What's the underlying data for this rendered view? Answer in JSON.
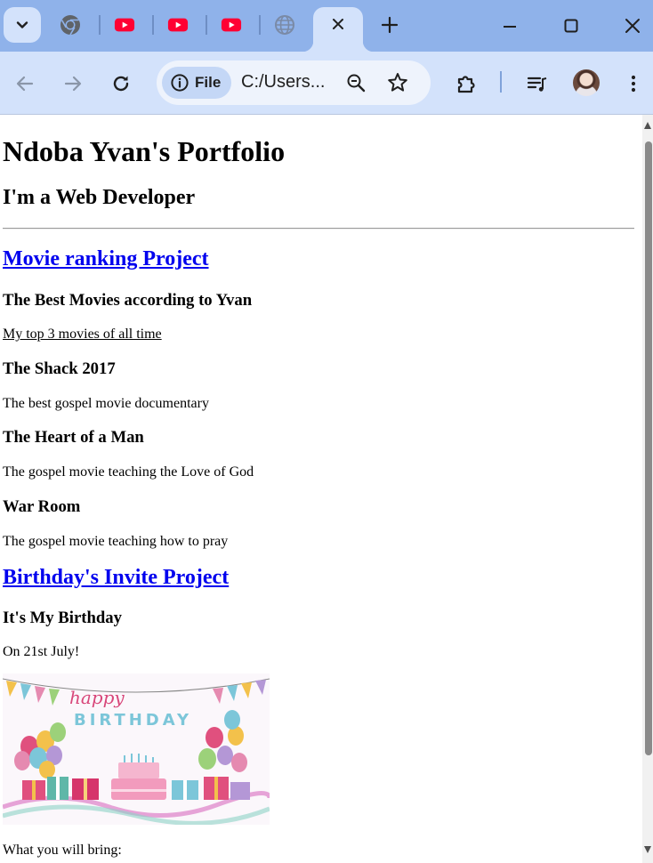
{
  "browser": {
    "tabs": [
      {
        "icon": "chrome-icon"
      },
      {
        "icon": "youtube-icon"
      },
      {
        "icon": "youtube-icon"
      },
      {
        "icon": "youtube-icon"
      },
      {
        "icon": "globe-icon",
        "active": true
      }
    ],
    "address": {
      "chip_label": "File",
      "url": "C:/Users..."
    },
    "colors": {
      "tab_strip": "#8fb2ea",
      "toolbar": "#d3e2fb",
      "youtube_red": "#ff0033"
    }
  },
  "page": {
    "title": "Ndoba Yvan's Portfolio",
    "subtitle": "I'm a Web Developer",
    "projects": {
      "movie": {
        "link": "Movie ranking Project",
        "heading": "The Best Movies according to Yvan",
        "subheading": "My top 3 movies of all time",
        "movies": [
          {
            "title": "The Shack 2017",
            "desc": "The best gospel movie documentary"
          },
          {
            "title": "The Heart of a Man",
            "desc": "The gospel movie teaching the Love of God"
          },
          {
            "title": "War Room",
            "desc": "The gospel movie teaching how to pray"
          }
        ]
      },
      "birthday": {
        "link": "Birthday's Invite Project",
        "heading": "It's My Birthday",
        "date": "On 21st July!",
        "image_text": "happy BIRTHDAY",
        "bring": "What you will bring:"
      }
    },
    "colors": {
      "link": "#0000ee"
    }
  }
}
